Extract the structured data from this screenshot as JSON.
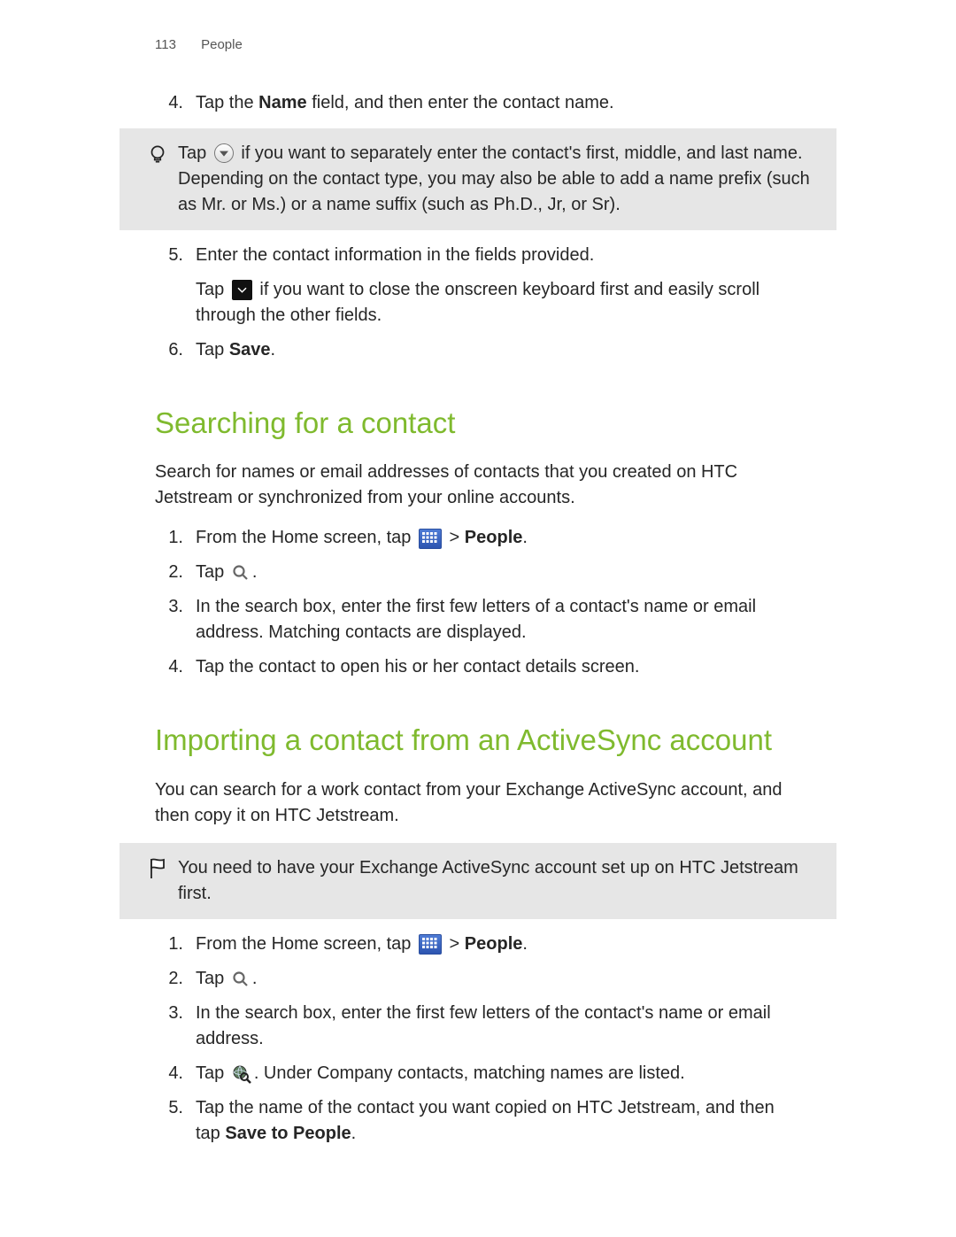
{
  "header": {
    "page_number": "113",
    "section": "People"
  },
  "step4": {
    "num": "4.",
    "pre": "Tap the ",
    "bold": "Name",
    "post": " field, and then enter the contact name."
  },
  "tip1": {
    "pre": "Tap ",
    "post": " if you want to separately enter the contact's first, middle, and last name. Depending on the contact type, you may also be able to add a name prefix (such as Mr. or Ms.) or a name suffix (such as Ph.D., Jr, or Sr)."
  },
  "step5": {
    "num": "5.",
    "line1": "Enter the contact information in the fields provided.",
    "line2_pre": "Tap ",
    "line2_post": " if you want to close the onscreen keyboard first and easily scroll through the other fields."
  },
  "step6": {
    "num": "6.",
    "pre": "Tap ",
    "bold": "Save",
    "post": "."
  },
  "section_search": {
    "title": "Searching for a contact",
    "intro": "Search for names or email addresses of contacts that you created on HTC Jetstream or synchronized from your online accounts.",
    "s1": {
      "num": "1.",
      "pre": "From the Home screen, tap ",
      "mid": " > ",
      "bold": "People",
      "post": "."
    },
    "s2": {
      "num": "2.",
      "pre": "Tap ",
      "post": "."
    },
    "s3": {
      "num": "3.",
      "text": "In the search box, enter the first few letters of a contact's name or email address. Matching contacts are displayed."
    },
    "s4": {
      "num": "4.",
      "text": "Tap the contact to open his or her contact details screen."
    }
  },
  "section_import": {
    "title": "Importing a contact from an ActiveSync account",
    "intro": "You can search for a work contact from your Exchange ActiveSync account, and then copy it on HTC Jetstream.",
    "warn": "You need to have your Exchange ActiveSync account set up on HTC Jetstream first.",
    "s1": {
      "num": "1.",
      "pre": "From the Home screen, tap ",
      "mid": " > ",
      "bold": "People",
      "post": "."
    },
    "s2": {
      "num": "2.",
      "pre": "Tap ",
      "post": "."
    },
    "s3": {
      "num": "3.",
      "text": "In the search box, enter the first few letters of the contact's name or email address."
    },
    "s4": {
      "num": "4.",
      "pre": "Tap ",
      "post": ". Under Company contacts, matching names are listed."
    },
    "s5": {
      "num": "5.",
      "pre": "Tap the name of the contact you want copied on HTC Jetstream, and then tap ",
      "bold": "Save to People",
      "post": "."
    }
  }
}
